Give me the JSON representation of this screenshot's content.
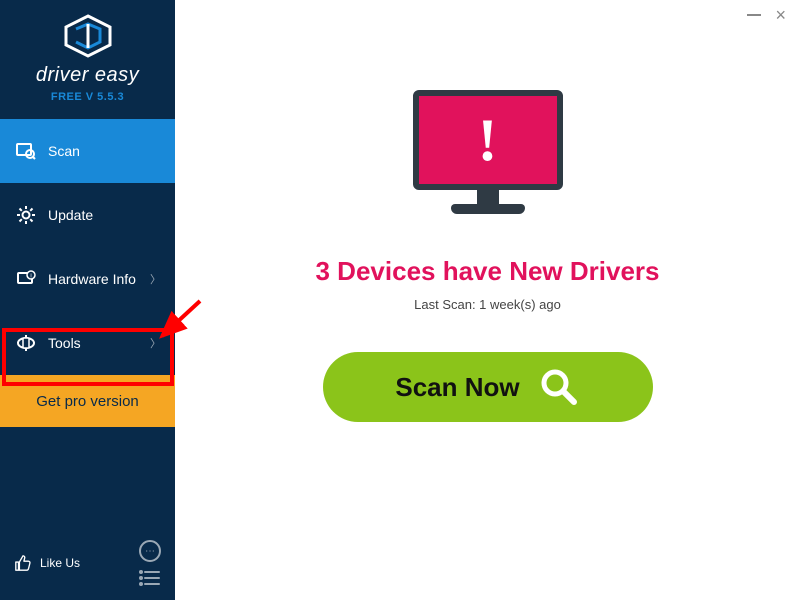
{
  "brand": {
    "name": "driver easy",
    "version": "FREE V 5.5.3"
  },
  "nav": {
    "scan": "Scan",
    "update": "Update",
    "hardware": "Hardware Info",
    "tools": "Tools"
  },
  "pro_label": "Get pro version",
  "likeus": "Like Us",
  "main": {
    "headline": "3 Devices have New Drivers",
    "lastscan": "Last Scan: 1 week(s) ago",
    "scan_label": "Scan Now"
  }
}
